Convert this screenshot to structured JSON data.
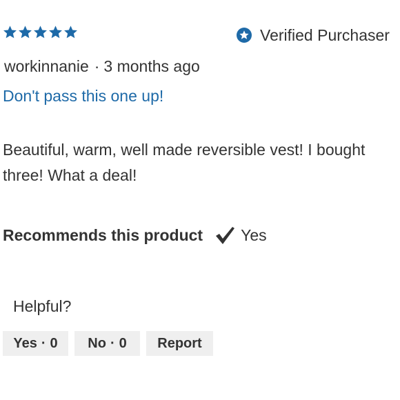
{
  "rating": {
    "stars": 5,
    "max_stars": 5,
    "icon": "star-icon",
    "color": "#1e6aa8"
  },
  "verified": {
    "icon": "verified-star-badge-icon",
    "label": "Verified Purchaser",
    "color": "#1e6aa8"
  },
  "byline": {
    "author": "workinnanie",
    "separator": "·",
    "date": "3 months ago"
  },
  "review": {
    "title": "Don't pass this one up!",
    "title_color": "#1e6aa8",
    "body": "Beautiful, warm, well made reversible vest! I bought three! What a deal!"
  },
  "recommendation": {
    "label": "Recommends this product",
    "icon": "checkmark-icon",
    "value": "Yes"
  },
  "helpful": {
    "label": "Helpful?",
    "yes": {
      "label": "Yes",
      "separator": "·",
      "count": "0"
    },
    "no": {
      "label": "No",
      "separator": "·",
      "count": "0"
    },
    "report": {
      "label": "Report"
    }
  }
}
